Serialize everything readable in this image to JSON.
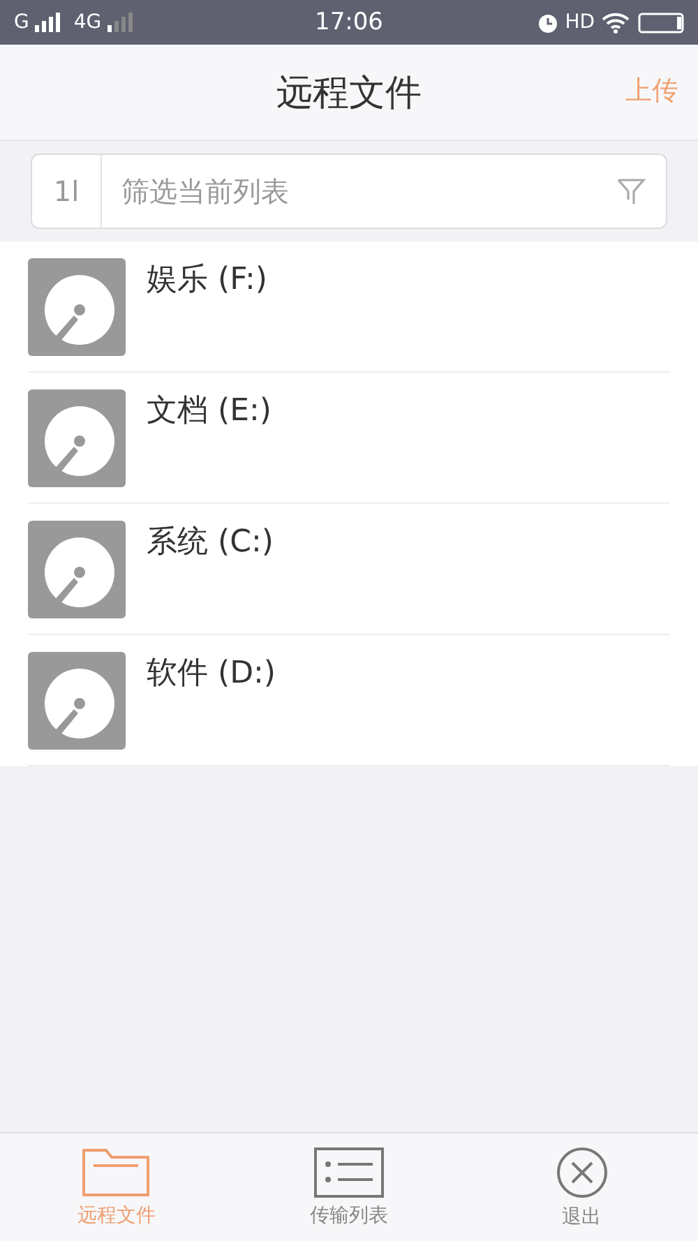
{
  "status_bar": {
    "carrier_1": "G",
    "carrier_2": "4G",
    "time": "17:06",
    "hd": "HD"
  },
  "header": {
    "title": "远程文件",
    "action": "上传"
  },
  "search": {
    "sort_icon": "1l",
    "placeholder": "筛选当前列表"
  },
  "drives": [
    {
      "label": "娱乐 (F:)"
    },
    {
      "label": "文档 (E:)"
    },
    {
      "label": "系统 (C:)"
    },
    {
      "label": "软件 (D:)"
    }
  ],
  "tabs": [
    {
      "label": "远程文件",
      "kind": "folder",
      "selected": true
    },
    {
      "label": "传输列表",
      "kind": "list",
      "selected": false
    },
    {
      "label": "退出",
      "kind": "exit",
      "selected": false
    }
  ]
}
